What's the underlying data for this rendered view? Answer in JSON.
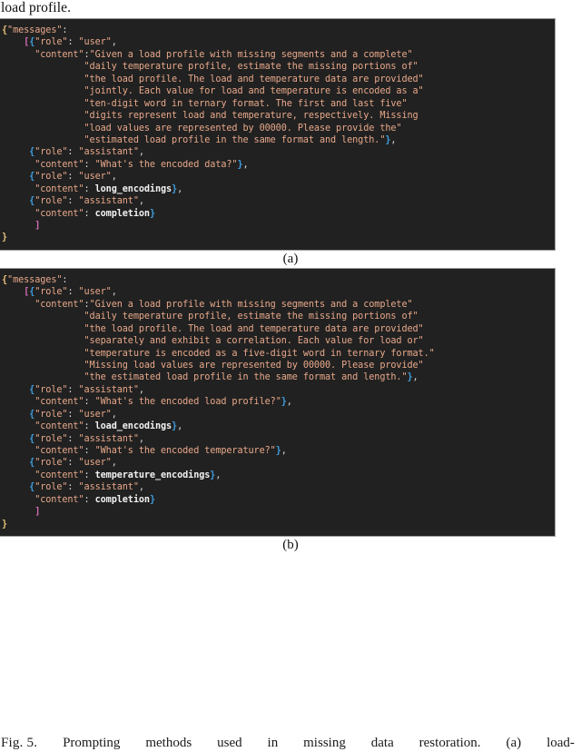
{
  "body_text_above": "load profile.",
  "panel_a": {
    "label": "(a)",
    "lines": [
      [
        {
          "t": "brace-outer",
          "x": "{"
        },
        {
          "t": "key",
          "x": "\"messages\""
        },
        {
          "t": "punct",
          "x": ":"
        }
      ],
      [
        {
          "t": "plain",
          "x": "    "
        },
        {
          "t": "bracket",
          "x": "["
        },
        {
          "t": "brace-inner",
          "x": "{"
        },
        {
          "t": "key",
          "x": "\"role\""
        },
        {
          "t": "punct",
          "x": ": "
        },
        {
          "t": "str",
          "x": "\"user\""
        },
        {
          "t": "punct",
          "x": ","
        }
      ],
      [
        {
          "t": "plain",
          "x": "      "
        },
        {
          "t": "key",
          "x": "\"content\""
        },
        {
          "t": "punct",
          "x": ":"
        },
        {
          "t": "str",
          "x": "\"Given a load profile with missing segments and a complete\""
        }
      ],
      [
        {
          "t": "plain",
          "x": "               "
        },
        {
          "t": "str",
          "x": "\"daily temperature profile, estimate the missing portions of\""
        }
      ],
      [
        {
          "t": "plain",
          "x": "               "
        },
        {
          "t": "str",
          "x": "\"the load profile. The load and temperature data are provided\""
        }
      ],
      [
        {
          "t": "plain",
          "x": "               "
        },
        {
          "t": "str",
          "x": "\"jointly. Each value for load and temperature is encoded as a\""
        }
      ],
      [
        {
          "t": "plain",
          "x": "               "
        },
        {
          "t": "str",
          "x": "\"ten-digit word in ternary format. The first and last five\""
        }
      ],
      [
        {
          "t": "plain",
          "x": "               "
        },
        {
          "t": "str",
          "x": "\"digits represent load and temperature, respectively. Missing"
        }
      ],
      [
        {
          "t": "plain",
          "x": "               "
        },
        {
          "t": "str",
          "x": "\"load values are represented by 00000. Please provide the\""
        }
      ],
      [
        {
          "t": "plain",
          "x": "               "
        },
        {
          "t": "str",
          "x": "\"estimated load profile in the same format and length.\""
        },
        {
          "t": "brace-inner",
          "x": "}"
        },
        {
          "t": "punct",
          "x": ","
        }
      ],
      [
        {
          "t": "plain",
          "x": "     "
        },
        {
          "t": "brace-inner",
          "x": "{"
        },
        {
          "t": "key",
          "x": "\"role\""
        },
        {
          "t": "punct",
          "x": ": "
        },
        {
          "t": "str",
          "x": "\"assistant\""
        },
        {
          "t": "punct",
          "x": ","
        }
      ],
      [
        {
          "t": "plain",
          "x": "      "
        },
        {
          "t": "key",
          "x": "\"content\""
        },
        {
          "t": "punct",
          "x": ": "
        },
        {
          "t": "str",
          "x": "\"What's the encoded data?\""
        },
        {
          "t": "brace-inner",
          "x": "}"
        },
        {
          "t": "punct",
          "x": ","
        }
      ],
      [
        {
          "t": "plain",
          "x": "     "
        },
        {
          "t": "brace-inner",
          "x": "{"
        },
        {
          "t": "key",
          "x": "\"role\""
        },
        {
          "t": "punct",
          "x": ": "
        },
        {
          "t": "str",
          "x": "\"user\""
        },
        {
          "t": "punct",
          "x": ","
        }
      ],
      [
        {
          "t": "plain",
          "x": "      "
        },
        {
          "t": "key",
          "x": "\"content\""
        },
        {
          "t": "punct",
          "x": ": "
        },
        {
          "t": "ident",
          "x": "long_encodings"
        },
        {
          "t": "brace-inner",
          "x": "}"
        },
        {
          "t": "punct",
          "x": ","
        }
      ],
      [
        {
          "t": "plain",
          "x": "     "
        },
        {
          "t": "brace-inner",
          "x": "{"
        },
        {
          "t": "key",
          "x": "\"role\""
        },
        {
          "t": "punct",
          "x": ": "
        },
        {
          "t": "str",
          "x": "\"assistant\""
        },
        {
          "t": "punct",
          "x": ","
        }
      ],
      [
        {
          "t": "plain",
          "x": "      "
        },
        {
          "t": "key",
          "x": "\"content\""
        },
        {
          "t": "punct",
          "x": ": "
        },
        {
          "t": "ident",
          "x": "completion"
        },
        {
          "t": "brace-inner",
          "x": "}"
        }
      ],
      [
        {
          "t": "plain",
          "x": "      "
        },
        {
          "t": "bracket",
          "x": "]"
        }
      ],
      [
        {
          "t": "brace-outer",
          "x": "}"
        }
      ]
    ]
  },
  "panel_b": {
    "label": "(b)",
    "lines": [
      [
        {
          "t": "brace-outer",
          "x": "{"
        },
        {
          "t": "key",
          "x": "\"messages\""
        },
        {
          "t": "punct",
          "x": ":"
        }
      ],
      [
        {
          "t": "plain",
          "x": "    "
        },
        {
          "t": "bracket",
          "x": "["
        },
        {
          "t": "brace-inner",
          "x": "{"
        },
        {
          "t": "key",
          "x": "\"role\""
        },
        {
          "t": "punct",
          "x": ": "
        },
        {
          "t": "str",
          "x": "\"user\""
        },
        {
          "t": "punct",
          "x": ","
        }
      ],
      [
        {
          "t": "plain",
          "x": "      "
        },
        {
          "t": "key",
          "x": "\"content\""
        },
        {
          "t": "punct",
          "x": ":"
        },
        {
          "t": "str",
          "x": "\"Given a load profile with missing segments and a complete\""
        }
      ],
      [
        {
          "t": "plain",
          "x": "               "
        },
        {
          "t": "str",
          "x": "\"daily temperature profile, estimate the missing portions of\""
        }
      ],
      [
        {
          "t": "plain",
          "x": "               "
        },
        {
          "t": "str",
          "x": "\"the load profile. The load and temperature data are provided\""
        }
      ],
      [
        {
          "t": "plain",
          "x": "               "
        },
        {
          "t": "str",
          "x": "\"separately and exhibit a correlation. Each value for load or\""
        }
      ],
      [
        {
          "t": "plain",
          "x": "               "
        },
        {
          "t": "str",
          "x": "\"temperature is encoded as a five-digit word in ternary format.\""
        }
      ],
      [
        {
          "t": "plain",
          "x": "               "
        },
        {
          "t": "str",
          "x": "\"Missing load values are represented by 00000. Please provide\""
        }
      ],
      [
        {
          "t": "plain",
          "x": "               "
        },
        {
          "t": "str",
          "x": "\"the estimated load profile in the same format and length.\""
        },
        {
          "t": "brace-inner",
          "x": "}"
        },
        {
          "t": "punct",
          "x": ","
        }
      ],
      [
        {
          "t": "plain",
          "x": "     "
        },
        {
          "t": "brace-inner",
          "x": "{"
        },
        {
          "t": "key",
          "x": "\"role\""
        },
        {
          "t": "punct",
          "x": ": "
        },
        {
          "t": "str",
          "x": "\"assistant\""
        },
        {
          "t": "punct",
          "x": ","
        }
      ],
      [
        {
          "t": "plain",
          "x": "      "
        },
        {
          "t": "key",
          "x": "\"content\""
        },
        {
          "t": "punct",
          "x": ": "
        },
        {
          "t": "str",
          "x": "\"What's the encoded load profile?\""
        },
        {
          "t": "brace-inner",
          "x": "}"
        },
        {
          "t": "punct",
          "x": ","
        }
      ],
      [
        {
          "t": "plain",
          "x": "     "
        },
        {
          "t": "brace-inner",
          "x": "{"
        },
        {
          "t": "key",
          "x": "\"role\""
        },
        {
          "t": "punct",
          "x": ": "
        },
        {
          "t": "str",
          "x": "\"user\""
        },
        {
          "t": "punct",
          "x": ","
        }
      ],
      [
        {
          "t": "plain",
          "x": "      "
        },
        {
          "t": "key",
          "x": "\"content\""
        },
        {
          "t": "punct",
          "x": ": "
        },
        {
          "t": "ident",
          "x": "load_encodings"
        },
        {
          "t": "brace-inner",
          "x": "}"
        },
        {
          "t": "punct",
          "x": ","
        }
      ],
      [
        {
          "t": "plain",
          "x": "     "
        },
        {
          "t": "brace-inner",
          "x": "{"
        },
        {
          "t": "key",
          "x": "\"role\""
        },
        {
          "t": "punct",
          "x": ": "
        },
        {
          "t": "str",
          "x": "\"assistant\""
        },
        {
          "t": "punct",
          "x": ","
        }
      ],
      [
        {
          "t": "plain",
          "x": "      "
        },
        {
          "t": "key",
          "x": "\"content\""
        },
        {
          "t": "punct",
          "x": ": "
        },
        {
          "t": "str",
          "x": "\"What's the encoded temperature?\""
        },
        {
          "t": "brace-inner",
          "x": "}"
        },
        {
          "t": "punct",
          "x": ","
        }
      ],
      [
        {
          "t": "plain",
          "x": "     "
        },
        {
          "t": "brace-inner",
          "x": "{"
        },
        {
          "t": "key",
          "x": "\"role\""
        },
        {
          "t": "punct",
          "x": ": "
        },
        {
          "t": "str",
          "x": "\"user\""
        },
        {
          "t": "punct",
          "x": ","
        }
      ],
      [
        {
          "t": "plain",
          "x": "      "
        },
        {
          "t": "key",
          "x": "\"content\""
        },
        {
          "t": "punct",
          "x": ": "
        },
        {
          "t": "ident",
          "x": "temperature_encodings"
        },
        {
          "t": "brace-inner",
          "x": "}"
        },
        {
          "t": "punct",
          "x": ","
        }
      ],
      [
        {
          "t": "plain",
          "x": "     "
        },
        {
          "t": "brace-inner",
          "x": "{"
        },
        {
          "t": "key",
          "x": "\"role\""
        },
        {
          "t": "punct",
          "x": ": "
        },
        {
          "t": "str",
          "x": "\"assistant\""
        },
        {
          "t": "punct",
          "x": ","
        }
      ],
      [
        {
          "t": "plain",
          "x": "      "
        },
        {
          "t": "key",
          "x": "\"content\""
        },
        {
          "t": "punct",
          "x": ": "
        },
        {
          "t": "ident",
          "x": "completion"
        },
        {
          "t": "brace-inner",
          "x": "}"
        }
      ],
      [
        {
          "t": "plain",
          "x": "      "
        },
        {
          "t": "bracket",
          "x": "]"
        }
      ],
      [
        {
          "t": "brace-outer",
          "x": "}"
        }
      ]
    ]
  },
  "figure_caption": {
    "label": "Fig. 5.",
    "text_parts": [
      "Prompting",
      "methods",
      "used",
      "in",
      "missing",
      "data",
      "restoration.",
      "(a)",
      "load-"
    ]
  },
  "colors": {
    "panel_background": "#212121",
    "panel_border": "#9a9a9a",
    "brace_outer": "#e5c07b",
    "bracket": "#d26bb5",
    "brace_inner": "#3f9fe0",
    "string": "#e8a88a",
    "identifier": "#f2f2f2",
    "punctuation": "#d8d8d8",
    "page_background": "#ffffff",
    "text": "#000000"
  }
}
